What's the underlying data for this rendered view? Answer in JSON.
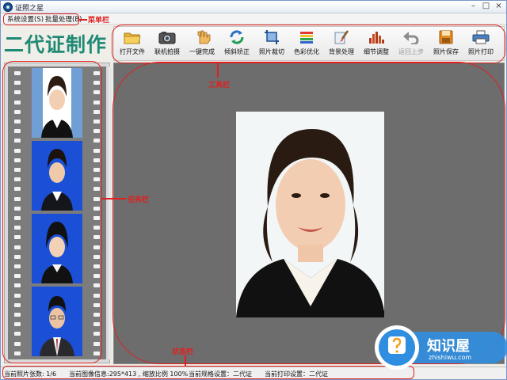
{
  "window": {
    "title": "证照之星",
    "minimize_glyph": "–",
    "maximize_glyph": "□",
    "close_glyph": "×"
  },
  "menu": {
    "items": [
      {
        "label": "系统设置(S)"
      },
      {
        "label": "批量处理(B)"
      }
    ]
  },
  "logo": {
    "text": "二代证制作"
  },
  "toolbar": {
    "items": [
      {
        "label": "打开文件",
        "icon": "folder-icon",
        "enabled": true
      },
      {
        "label": "联机拍摄",
        "icon": "camera-icon",
        "enabled": true
      },
      {
        "label": "一键完成",
        "icon": "hand-click-icon",
        "enabled": true
      },
      {
        "label": "倾斜矫正",
        "icon": "rotate-icon",
        "enabled": true
      },
      {
        "label": "照片裁切",
        "icon": "crop-icon",
        "enabled": true
      },
      {
        "label": "色彩优化",
        "icon": "color-bars-icon",
        "enabled": true
      },
      {
        "label": "背景处理",
        "icon": "brush-icon",
        "enabled": true
      },
      {
        "label": "细节调整",
        "icon": "histogram-icon",
        "enabled": true
      },
      {
        "label": "返回上步",
        "icon": "undo-icon",
        "enabled": false
      },
      {
        "label": "照片保存",
        "icon": "save-icon",
        "enabled": true
      },
      {
        "label": "照片打印",
        "icon": "printer-icon",
        "enabled": true
      }
    ]
  },
  "taskpane": {
    "photos": [
      {
        "background": "#6f9fd4"
      },
      {
        "background": "#1a4fd6"
      },
      {
        "background": "#1a4fd6"
      },
      {
        "background": "#1a4fd6"
      }
    ]
  },
  "statusbar": {
    "photo_count": "当前照片张数: 1/6",
    "image_info": "当前图像信息:295*413 , 缩放比例 100%",
    "spec_setting": "当前规格设置：二代证",
    "print_setting": "当前打印设置：二代证"
  },
  "annotations": {
    "menubar": "菜单栏",
    "toolbar": "工具栏",
    "taskpane": "任务栏",
    "statusbar": "状态栏"
  },
  "watermark": {
    "brand": "知识屋",
    "url": "zhishiwu.com"
  },
  "colors": {
    "logo": "#1f8a74",
    "annotation": "#e02020",
    "canvas": "#6d6d6d",
    "photo_blue": "#1a4fd6"
  }
}
